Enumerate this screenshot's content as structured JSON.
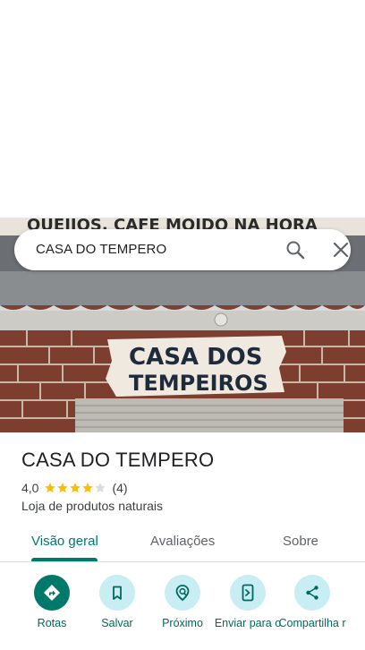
{
  "search": {
    "query": "CASA DO TEMPERO"
  },
  "photo": {
    "sign_line1": "CASA DOS",
    "sign_line2": "TEMPEIROS",
    "banner_text": "QUEIJOS, CAFE MOIDO NA HORA"
  },
  "place": {
    "title": "CASA DO TEMPERO",
    "rating": "4,0",
    "stars_filled": 4,
    "stars_total": 5,
    "review_count": "(4)",
    "category": "Loja de produtos naturais"
  },
  "tabs": [
    {
      "label": "Visão geral",
      "active": true
    },
    {
      "label": "Avaliações",
      "active": false
    },
    {
      "label": "Sobre",
      "active": false
    }
  ],
  "actions": [
    {
      "label": "Rotas",
      "icon": "directions-icon"
    },
    {
      "label": "Salvar",
      "icon": "bookmark-icon"
    },
    {
      "label": "Próximo",
      "icon": "nearby-icon"
    },
    {
      "label": "Enviar para o",
      "icon": "send-to-phone-icon"
    },
    {
      "label": "Compartilha r",
      "icon": "share-icon"
    }
  ],
  "colors": {
    "accent": "#00796b",
    "action_bg": "#c8eef4",
    "star": "#fbbc04",
    "star_empty": "#dadce0"
  }
}
